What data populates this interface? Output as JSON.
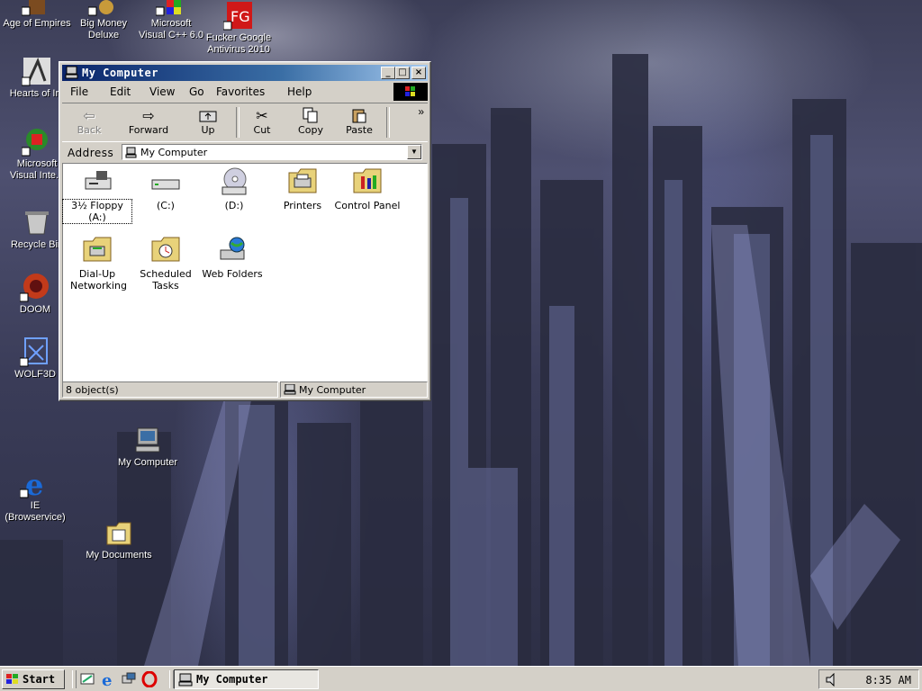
{
  "desktop": {
    "icons": [
      {
        "label": "Age of Empires"
      },
      {
        "label": "Big Money Deluxe"
      },
      {
        "label": "Microsoft Visual C++ 6.0"
      },
      {
        "label": "Fucker Google Antivirus 2010"
      },
      {
        "label": "Hearts of Iro"
      },
      {
        "label": "Microsoft Visual Inte..."
      },
      {
        "label": "Recycle Bin"
      },
      {
        "label": "DOOM"
      },
      {
        "label": "WOLF3D"
      },
      {
        "label": "My Computer"
      },
      {
        "label": "IE (Browservice)"
      },
      {
        "label": "My Documents"
      }
    ]
  },
  "window": {
    "title": "My Computer",
    "controls": {
      "minimize": "_",
      "maximize": "□",
      "close": "×"
    },
    "menu": [
      "File",
      "Edit",
      "View",
      "Go",
      "Favorites",
      "Help"
    ],
    "toolbar": {
      "back": "Back",
      "forward": "Forward",
      "up": "Up",
      "cut": "Cut",
      "copy": "Copy",
      "paste": "Paste",
      "more": "»"
    },
    "address": {
      "label": "Address",
      "value": "My Computer"
    },
    "items": [
      {
        "label": "3½ Floppy (A:)"
      },
      {
        "label": "(C:)"
      },
      {
        "label": "(D:)"
      },
      {
        "label": "Printers"
      },
      {
        "label": "Control Panel"
      },
      {
        "label": "Dial-Up Networking"
      },
      {
        "label": "Scheduled Tasks"
      },
      {
        "label": "Web Folders"
      }
    ],
    "status": {
      "count": "8 object(s)",
      "location": "My Computer"
    }
  },
  "taskbar": {
    "start_label": "Start",
    "task_label": "My Computer",
    "clock": "8:35 AM"
  }
}
